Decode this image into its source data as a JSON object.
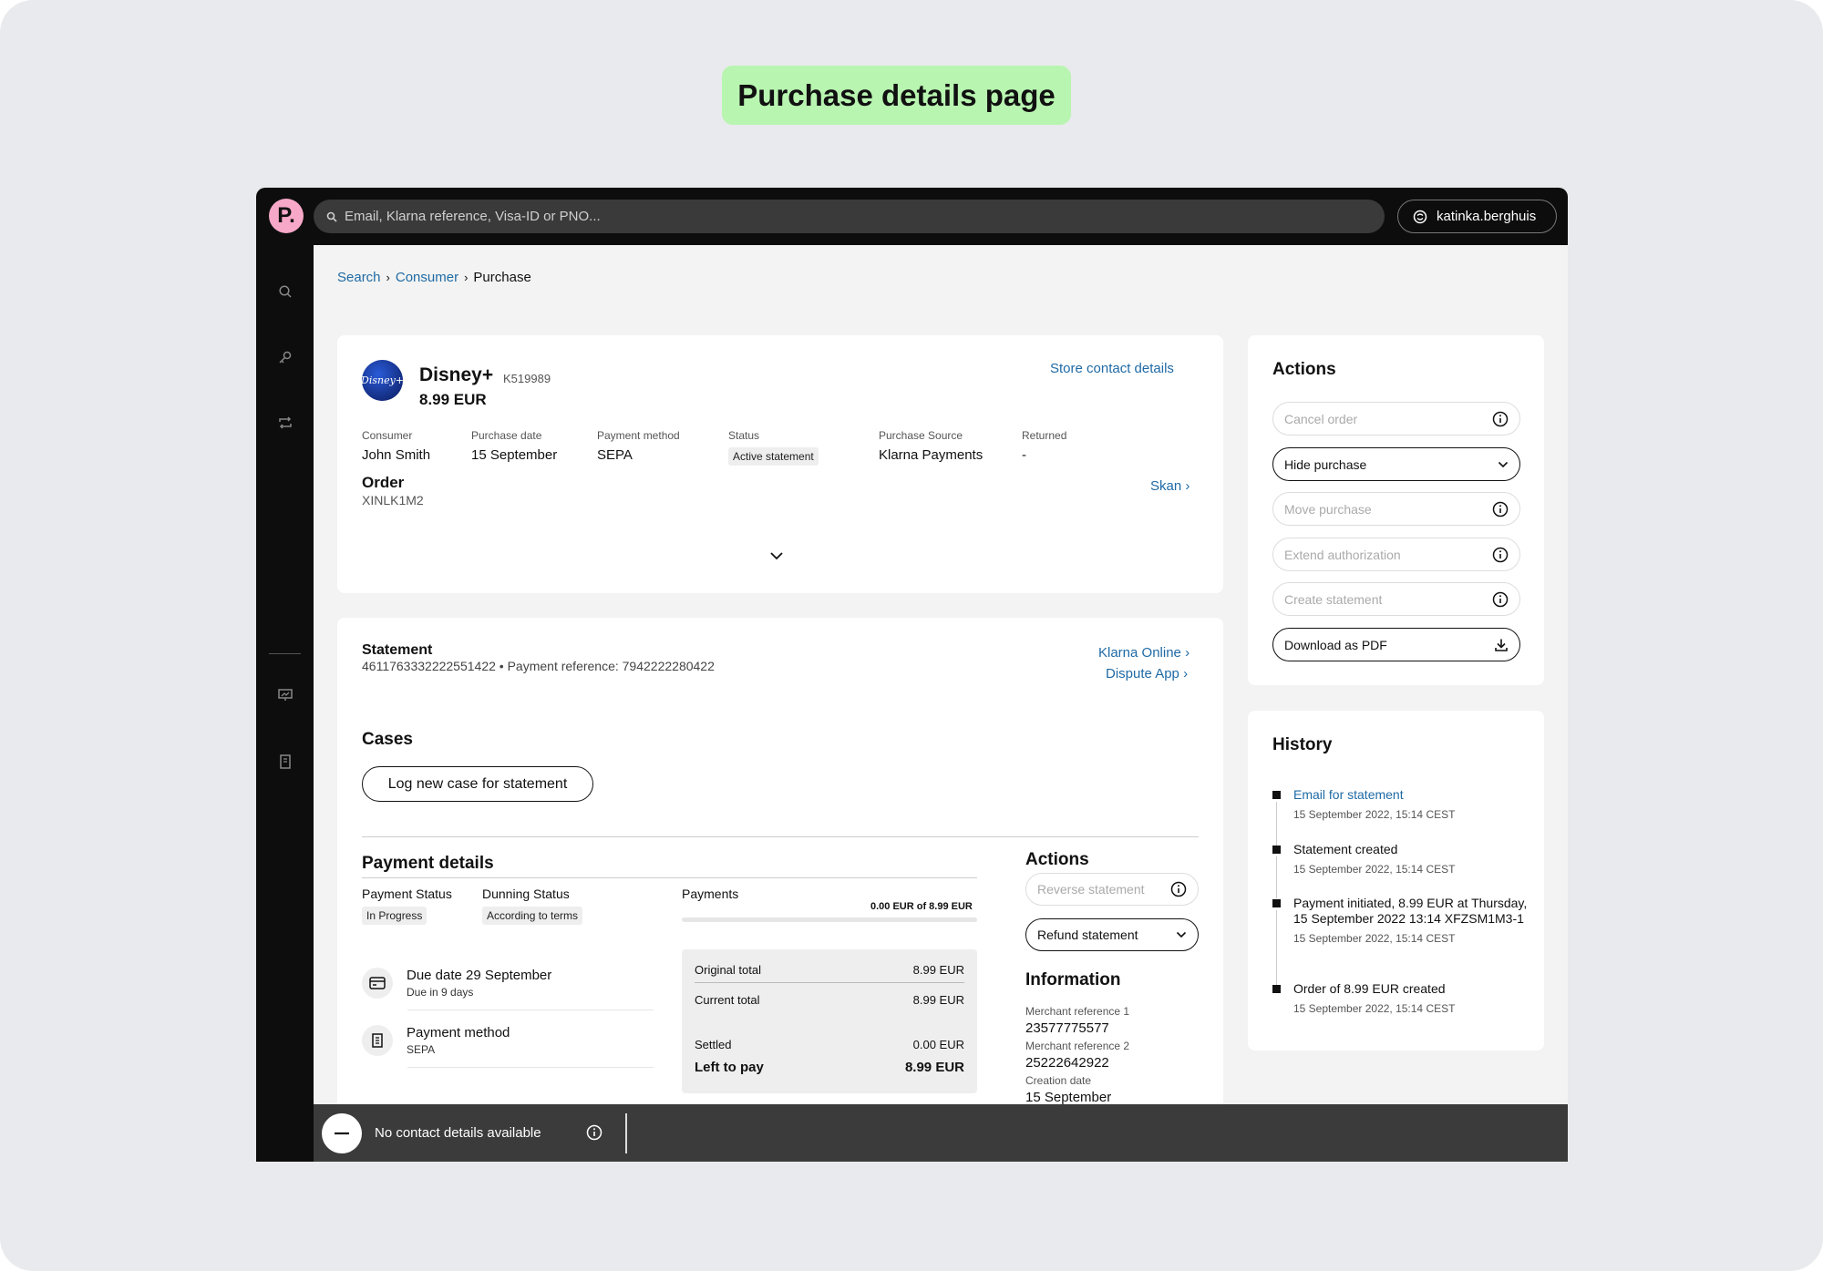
{
  "page_label": "Purchase details page",
  "topbar": {
    "logo": "P.",
    "search_placeholder": "Email, Klarna reference, Visa-ID or PNO...",
    "user_name": "katinka.berghuis"
  },
  "breadcrumb": {
    "items": [
      "Search",
      "Consumer",
      "Purchase"
    ]
  },
  "summary": {
    "merchant_logo_text": "Disney+",
    "merchant_name": "Disney+",
    "merchant_id": "K519989",
    "amount": "8.99 EUR",
    "store_contact_link": "Store contact details",
    "fields": [
      {
        "label": "Consumer",
        "value": "John Smith"
      },
      {
        "label": "Purchase date",
        "value": "15 September"
      },
      {
        "label": "Payment method",
        "value": "SEPA"
      },
      {
        "label": "Status",
        "value": "Active statement"
      },
      {
        "label": "Purchase Source",
        "value": "Klarna Payments"
      },
      {
        "label": "Returned",
        "value": "-"
      }
    ],
    "order_label": "Order",
    "order_id": "XINLK1M2",
    "skan_link": "Skan"
  },
  "statement": {
    "title": "Statement",
    "number": "4611763332222551422",
    "payment_reference": "• Payment reference: 7942222280422",
    "klarna_online_link": "Klarna Online",
    "dispute_app_link": "Dispute App",
    "cases_title": "Cases",
    "log_case_button": "Log new case for statement",
    "payment_details": {
      "title": "Payment details",
      "payment_status_label": "Payment Status",
      "payment_status_value": "In Progress",
      "dunning_status_label": "Dunning Status",
      "dunning_status_value": "According to terms",
      "payments_label": "Payments",
      "payments_amount": "0.00 EUR of 8.99 EUR",
      "payments_progress": 0,
      "due_date_title": "Due date 29 September",
      "due_date_sub": "Due in 9 days",
      "payment_method_title": "Payment method",
      "payment_method_sub": "SEPA",
      "totals": {
        "original_total_label": "Original total",
        "original_total_value": "8.99 EUR",
        "current_total_label": "Current total",
        "current_total_value": "8.99 EUR",
        "settled_label": "Settled",
        "settled_value": "0.00 EUR",
        "left_to_pay_label": "Left to pay",
        "left_to_pay_value": "8.99 EUR"
      }
    },
    "actions": {
      "title": "Actions",
      "reverse_statement": "Reverse statement",
      "refund_statement": "Refund statement"
    },
    "information": {
      "title": "Information",
      "merchant_ref1_label": "Merchant reference 1",
      "merchant_ref1_value": "23577775577",
      "merchant_ref2_label": "Merchant reference 2",
      "merchant_ref2_value": "25222642922",
      "creation_date_label": "Creation date",
      "creation_date_value": "15 September"
    }
  },
  "actions_card": {
    "title": "Actions",
    "buttons": [
      {
        "label": "Cancel order",
        "state": "disabled",
        "icon": "info-icon"
      },
      {
        "label": "Hide purchase",
        "state": "enabled",
        "icon": "chevron-down-icon"
      },
      {
        "label": "Move purchase",
        "state": "disabled",
        "icon": "info-icon"
      },
      {
        "label": "Extend authorization",
        "state": "disabled",
        "icon": "info-icon"
      },
      {
        "label": "Create statement",
        "state": "disabled",
        "icon": "info-icon"
      },
      {
        "label": "Download as PDF",
        "state": "enabled",
        "icon": "download-icon"
      }
    ]
  },
  "history": {
    "title": "History",
    "items": [
      {
        "text": "Email for statement",
        "time": "15 September 2022, 15:14 CEST"
      },
      {
        "text": "Statement created",
        "time": "15 September 2022, 15:14 CEST"
      },
      {
        "text": "Payment initiated, 8.99 EUR at Thursday, 15 September 2022 13:14 XFZSM1M3-1",
        "time": "15 September 2022, 15:14 CEST"
      },
      {
        "text": "Order of 8.99 EUR created",
        "time": "15 September 2022, 15:14 CEST"
      }
    ]
  },
  "footer": {
    "contact_text": "No contact details available"
  },
  "colors": {
    "link": "#1f6aa5",
    "label_bg": "#b8f5b0",
    "topbar": "#0d0d0d",
    "logo_pink": "#f7a8c8",
    "footer": "#3b3b3b"
  }
}
